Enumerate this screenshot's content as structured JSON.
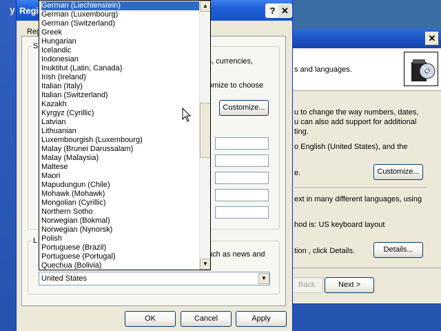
{
  "desktop": {
    "corner_glyph": "y"
  },
  "wizard": {
    "close_glyph": "✕",
    "header_text": "s and languages.",
    "lines": [
      "u to change the way numbers, dates,",
      "u can also add support for additional",
      "ting.",
      "o English (United States), and the",
      "e.",
      "ext in many different languages, using",
      "hod is: US keyboard layout",
      "tion , click Details."
    ],
    "customize_label": "Customize...",
    "details_label": "Details...",
    "back_label": "Back",
    "next_label": "Next >"
  },
  "dialog": {
    "title": "Regio",
    "help_glyph": "?",
    "close_glyph": "✕",
    "tab_label": "Reg",
    "group1_label": "S",
    "group2_label": "L",
    "panel_text_1": "rs, currencies,",
    "panel_text_2": "omize to choose",
    "customize_label": "Customize...",
    "panel_text_3": "uch as news and",
    "combo_value": "United States",
    "ok_label": "OK",
    "cancel_label": "Cancel",
    "apply_label": "Apply"
  },
  "dropdown": {
    "items": [
      "German (Liechtenstein)",
      "German (Luxembourg)",
      "German (Switzerland)",
      "Greek",
      "Hungarian",
      "Icelandic",
      "Indonesian",
      "Inuktitut (Latin, Canada)",
      "Irish (Ireland)",
      "Italian (Italy)",
      "Italian (Switzerland)",
      "Kazakh",
      "Kyrgyz (Cyrillic)",
      "Latvian",
      "Lithuanian",
      "Luxembourgish (Luxembourg)",
      "Malay (Brunei Darussalam)",
      "Malay (Malaysia)",
      "Maltese",
      "Maori",
      "Mapudungun (Chile)",
      "Mohawk (Mohawk)",
      "Mongolian (Cyrillic)",
      "Northern Sotho",
      "Norwegian (Bokmal)",
      "Norwegian (Nynorsk)",
      "Polish",
      "Portuguese (Brazil)",
      "Portuguese (Portugal)",
      "Quechua (Bolivia)"
    ],
    "selected_index": 0,
    "scroll_up_glyph": "▲",
    "scroll_down_glyph": "▼",
    "combo_arrow_glyph": "▼"
  },
  "colors": {
    "selection": "#316ac5",
    "titlebar": "#1f5fd9",
    "dialog_face": "#ece9d8"
  }
}
